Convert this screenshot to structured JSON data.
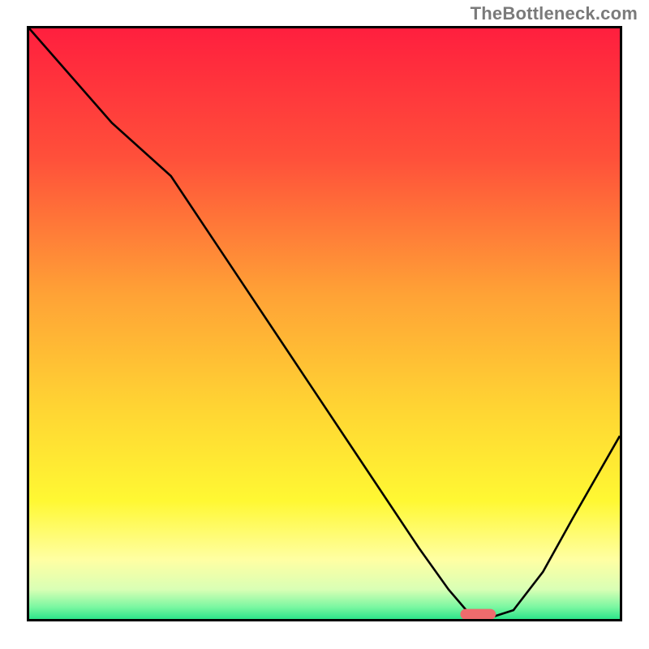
{
  "watermark": "TheBottleneck.com",
  "chart_data": {
    "type": "line",
    "title": "",
    "xlabel": "",
    "ylabel": "",
    "xlim": [
      0,
      100
    ],
    "ylim": [
      0,
      100
    ],
    "grid": false,
    "background": {
      "type": "vertical_gradient",
      "stops": [
        {
          "offset": 0,
          "color": "#ff1f3e"
        },
        {
          "offset": 22,
          "color": "#ff503a"
        },
        {
          "offset": 45,
          "color": "#ffa236"
        },
        {
          "offset": 64,
          "color": "#ffd433"
        },
        {
          "offset": 80,
          "color": "#fff833"
        },
        {
          "offset": 90,
          "color": "#ffffa3"
        },
        {
          "offset": 95,
          "color": "#d9ffb5"
        },
        {
          "offset": 98,
          "color": "#7af7a1"
        },
        {
          "offset": 100,
          "color": "#2de58a"
        }
      ]
    },
    "series": [
      {
        "name": "curve",
        "color": "#000000",
        "stroke_width": 2.6,
        "x": [
          0,
          7,
          14,
          24,
          34,
          44,
          54,
          60,
          66,
          71,
          74,
          78,
          82,
          87,
          92,
          96,
          100
        ],
        "y": [
          100,
          92,
          84,
          75,
          60,
          45,
          30,
          21,
          12,
          5,
          1.5,
          0.2,
          1.5,
          8,
          17,
          24,
          31
        ]
      }
    ],
    "marker": {
      "name": "optimal-marker",
      "color": "#ef6b6d",
      "shape": "rounded_rect",
      "x_center": 76,
      "y_center": 0.8,
      "width": 6,
      "height": 1.8,
      "corner_radius": 0.9
    }
  }
}
